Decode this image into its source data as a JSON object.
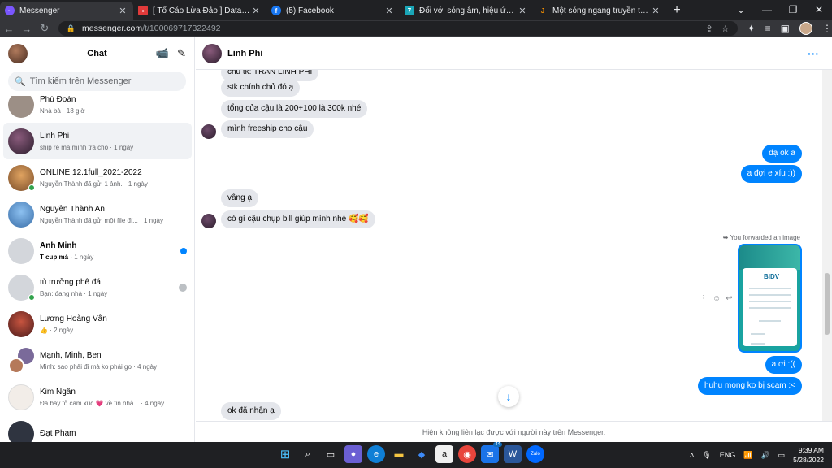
{
  "browser": {
    "tabs": [
      {
        "title": "Messenger",
        "icon": "messenger-icon",
        "color": "#7a56ff",
        "active": true
      },
      {
        "title": "[ Tố Cáo Lừa Đảo ] Data hệ thống",
        "icon": "lock-icon",
        "color": "#e03a3a",
        "active": false
      },
      {
        "title": "(5) Facebook",
        "icon": "facebook-icon",
        "color": "#1877f2",
        "active": false
      },
      {
        "title": "Đối với sóng âm, hiệu ứng Đốp-ple",
        "icon": "site-icon",
        "color": "#1aa6b7",
        "active": false
      },
      {
        "title": "Một sóng ngang truyền theo chiều",
        "icon": "site-icon",
        "color": "#f08c00",
        "active": false
      }
    ],
    "url_host": "messenger.com",
    "url_path": "/t/100069717322492"
  },
  "sidebar": {
    "title": "Chat",
    "search_placeholder": "Tìm kiếm trên Messenger",
    "conversations": [
      {
        "name": "Phú Đoàn",
        "preview": "Nhà bà",
        "time": "18 giờ",
        "bold": false,
        "online": false,
        "avatar": "#9c8f86"
      },
      {
        "name": "Linh Phi",
        "preview": "ship rẻ mà mình trả cho",
        "time": "1 ngày",
        "bold": false,
        "online": false,
        "avatar": "#4a2e3d",
        "active": true
      },
      {
        "name": "ONLINE 12.1full_2021-2022",
        "preview": "Nguyễn Thành đã gửi 1 ảnh.",
        "time": "1 ngày",
        "bold": false,
        "online": true,
        "avatar": "#d98a3b"
      },
      {
        "name": "Nguyễn Thành An",
        "preview": "Nguyễn Thành đã gửi một file đí...",
        "time": "1 ngày",
        "bold": false,
        "online": false,
        "avatar": "#5b8fd1"
      },
      {
        "name": "Anh Minh",
        "preview": "T cup má",
        "time": "1 ngày",
        "bold": true,
        "online": false,
        "avatar": "#d3d6db",
        "unread": true
      },
      {
        "name": "tù trưởng phê đá",
        "preview": "Bạn: đang nhà",
        "time": "1 ngày",
        "bold": false,
        "online": true,
        "avatar": "#d3d6db",
        "muted": true
      },
      {
        "name": "Lương Hoàng Vân",
        "preview": "👍",
        "time": "2 ngày",
        "bold": false,
        "online": false,
        "avatar": "#8b2c2c"
      },
      {
        "name": "Mạnh, Minh, Ben",
        "preview": "Minh: sao phải đi mà ko phải go",
        "time": "4 ngày",
        "bold": false,
        "online": false,
        "avatar": "#7a6a9a"
      },
      {
        "name": "Kim Ngân",
        "preview": "Đã bày tỏ cảm xúc 💗 về tin nhắ...",
        "time": "4 ngày",
        "bold": false,
        "online": false,
        "avatar": "#f2ede8"
      },
      {
        "name": "Đạt Phạm",
        "preview": "",
        "time": "",
        "bold": false,
        "online": false,
        "avatar": "#2f3440"
      }
    ]
  },
  "chat": {
    "contact_name": "Linh Phi",
    "messages_in_top": [
      "chủ tk: TRẦN LINH PHI",
      "stk chính chủ đó ạ",
      "tổng của cậu là 200+100 là 300k nhé",
      "mình freeship cho cậu"
    ],
    "messages_out_1": [
      "dạ ok a",
      "a đợi e xíu :))"
    ],
    "messages_in_mid": [
      "vâng ạ",
      "có gì cậu chụp bill giúp mình nhé 🥰🥰"
    ],
    "forwarded_label": "You forwarded an image",
    "forwarded_image_brand": "BIDV",
    "messages_out_2": [
      "a ơi :((",
      "huhu mong ko bị scam :<"
    ],
    "messages_in_bottom": [
      "ok đã nhận ạ"
    ],
    "footer_note": "Hiện không liên lạc được với người này trên Messenger."
  },
  "taskbar": {
    "language": "ENG",
    "time": "9:39 AM",
    "date": "5/28/2022",
    "mail_badge": "44",
    "zalo_label": "Zalo"
  }
}
